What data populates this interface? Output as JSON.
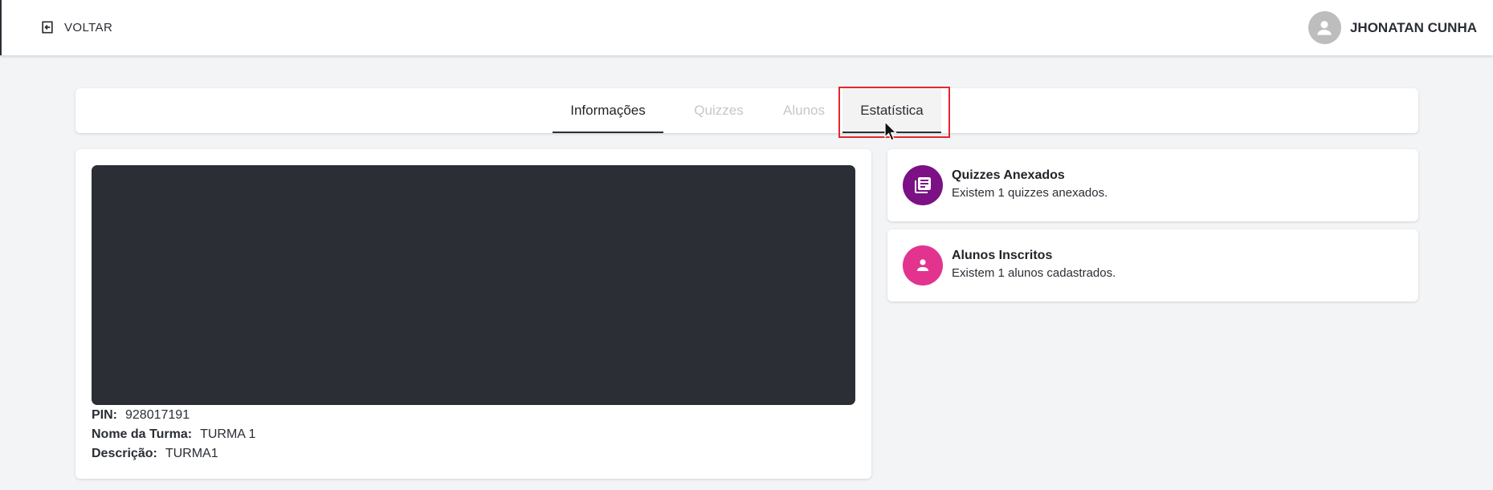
{
  "header": {
    "back_label": "VOLTAR",
    "back_icon": "exit-arrow-icon",
    "user_name": "JHONATAN CUNHA",
    "avatar_icon": "person-icon"
  },
  "tabs": [
    {
      "label": "Informações",
      "state": "active"
    },
    {
      "label": "Quizzes",
      "state": "disabled"
    },
    {
      "label": "Alunos",
      "state": "disabled"
    },
    {
      "label": "Estatística",
      "state": "hovered"
    }
  ],
  "info": {
    "pin_label": "PIN:",
    "pin_value": "928017191",
    "class_name_label": "Nome da Turma:",
    "class_name_value": "TURMA 1",
    "description_label": "Descrição:",
    "description_value": "TURMA1"
  },
  "stats": [
    {
      "title": "Quizzes Anexados",
      "description": "Existem 1 quizzes anexados.",
      "icon": "library-books-icon",
      "color": "#7b1185"
    },
    {
      "title": "Alunos Inscritos",
      "description": "Existem 1 alunos cadastrados.",
      "icon": "person-icon",
      "color": "#e2348f"
    }
  ],
  "colors": {
    "highlight_border": "#e5262d",
    "media_background": "#2c2e35",
    "page_background": "#f3f4f6"
  }
}
